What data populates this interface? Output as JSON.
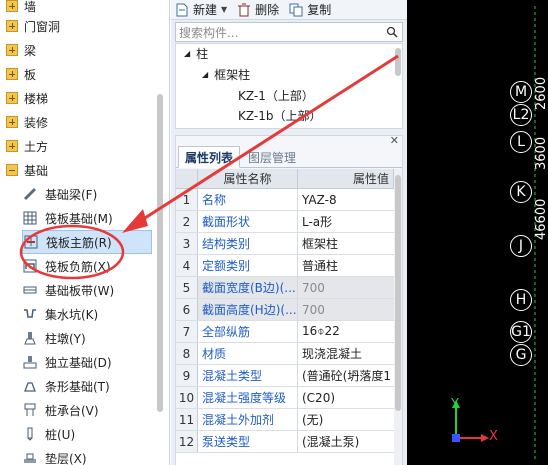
{
  "left_tree": {
    "categories": [
      {
        "label": "墙",
        "expanded": false
      },
      {
        "label": "门窗洞",
        "expanded": false
      },
      {
        "label": "梁",
        "expanded": false
      },
      {
        "label": "板",
        "expanded": false
      },
      {
        "label": "楼梯",
        "expanded": false
      },
      {
        "label": "装修",
        "expanded": false
      },
      {
        "label": "土方",
        "expanded": false
      },
      {
        "label": "基础",
        "expanded": true
      }
    ],
    "items": [
      {
        "label": "基础梁(F)",
        "icon": "beam-icon"
      },
      {
        "label": "筏板基础(M)",
        "icon": "grid-icon"
      },
      {
        "label": "筏板主筋(R)",
        "icon": "rebar-main-icon"
      },
      {
        "label": "筏板负筋(X)",
        "icon": "rebar-neg-icon"
      },
      {
        "label": "基础板带(W)",
        "icon": "strip-icon"
      },
      {
        "label": "集水坑(K)",
        "icon": "pit-icon"
      },
      {
        "label": "柱墩(Y)",
        "icon": "pier-icon"
      },
      {
        "label": "独立基础(D)",
        "icon": "footing-icon"
      },
      {
        "label": "条形基础(T)",
        "icon": "strip-footing-icon"
      },
      {
        "label": "桩承台(V)",
        "icon": "pile-cap-icon"
      },
      {
        "label": "桩(U)",
        "icon": "pile-icon"
      },
      {
        "label": "垫层(X)",
        "icon": "cushion-icon"
      }
    ]
  },
  "toolbar": {
    "new_label": "新建",
    "delete_label": "删除",
    "copy_label": "复制"
  },
  "search": {
    "placeholder": "搜索构件..."
  },
  "component_tree": {
    "root": "柱",
    "group": "框架柱",
    "items": [
      "KZ-1（上部）",
      "KZ-1b（上部）"
    ]
  },
  "props": {
    "tab_active": "属性列表",
    "tab_inactive": "图层管理",
    "col_name": "属性名称",
    "col_value": "属性值",
    "rows": [
      {
        "n": "1",
        "k": "名称",
        "v": "YAZ-8",
        "dis": false
      },
      {
        "n": "2",
        "k": "截面形状",
        "v": "L-a形",
        "dis": false
      },
      {
        "n": "3",
        "k": "结构类别",
        "v": "框架柱",
        "dis": false
      },
      {
        "n": "4",
        "k": "定额类别",
        "v": "普通柱",
        "dis": false
      },
      {
        "n": "5",
        "k": "截面宽度(B边)(...",
        "v": "700",
        "dis": true
      },
      {
        "n": "6",
        "k": "截面高度(H边)(...",
        "v": "700",
        "dis": true
      },
      {
        "n": "7",
        "k": "全部纵筋",
        "v": "16⌽22",
        "dis": false
      },
      {
        "n": "8",
        "k": "材质",
        "v": "现浇混凝土",
        "dis": false
      },
      {
        "n": "9",
        "k": "混凝土类型",
        "v": "(普通砼(坍落度1",
        "dis": false
      },
      {
        "n": "10",
        "k": "混凝土强度等级",
        "v": "(C20)",
        "dis": false
      },
      {
        "n": "11",
        "k": "混凝土外加剂",
        "v": "(无)",
        "dis": false
      },
      {
        "n": "12",
        "k": "泵送类型",
        "v": "(混凝土泵)",
        "dis": false
      }
    ]
  },
  "cad": {
    "axis_labels": [
      "M",
      "L2",
      "L",
      "K",
      "J",
      "H",
      "G1",
      "G"
    ],
    "vertical_texts": [
      "46600",
      "3600",
      "2600"
    ],
    "ucs_x": "X",
    "ucs_y": "Y",
    "colors": {
      "bg": "#000000",
      "x_axis": "#e8343b",
      "y_axis": "#1fd13b",
      "origin": "#3a52ff"
    }
  },
  "annotation": {
    "arrow_color": "#e63a3a",
    "circle_color": "#e63a3a"
  }
}
